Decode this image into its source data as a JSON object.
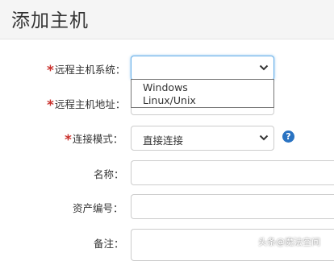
{
  "page": {
    "title": "添加主机"
  },
  "form": {
    "required_mark": "*",
    "remote_os": {
      "label": "远程主机系统：",
      "value": "",
      "options": [
        "Windows",
        "Linux/Unix"
      ]
    },
    "remote_address": {
      "label": "远程主机地址：",
      "value": ""
    },
    "connect_mode": {
      "label": "连接模式：",
      "value": "直接连接"
    },
    "name": {
      "label": "名称：",
      "value": ""
    },
    "asset_no": {
      "label": "资产编号：",
      "value": ""
    },
    "note": {
      "label": "备注：",
      "value": ""
    }
  },
  "help": {
    "glyph": "?"
  },
  "watermark": {
    "text": "头条@魔法空间"
  }
}
